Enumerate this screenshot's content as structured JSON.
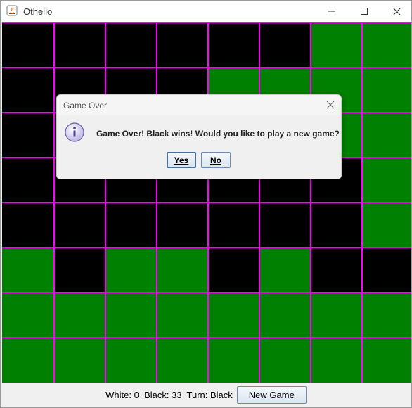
{
  "window": {
    "title": "Othello"
  },
  "colors": {
    "green": "#008000",
    "black": "#000000",
    "grid": "#ff00ff"
  },
  "board": {
    "rows": [
      [
        "B",
        "B",
        "B",
        "B",
        "B",
        "B",
        "G",
        "G"
      ],
      [
        "B",
        "B",
        "B",
        "B",
        "G",
        "G",
        "G",
        "G"
      ],
      [
        "B",
        "B",
        "B",
        "B",
        "B",
        "B",
        "G",
        "G"
      ],
      [
        "B",
        "B",
        "B",
        "B",
        "B",
        "B",
        "B",
        "G"
      ],
      [
        "B",
        "B",
        "B",
        "B",
        "B",
        "B",
        "B",
        "G"
      ],
      [
        "G",
        "B",
        "G",
        "G",
        "B",
        "G",
        "B",
        "B"
      ],
      [
        "G",
        "G",
        "G",
        "G",
        "G",
        "G",
        "G",
        "G"
      ],
      [
        "G",
        "G",
        "G",
        "G",
        "G",
        "G",
        "G",
        "G"
      ]
    ]
  },
  "status": {
    "text": "White: 0  Black: 33  Turn: Black",
    "new_game_label": "New Game"
  },
  "dialog": {
    "title": "Game Over",
    "message": "Game Over! Black wins! Would you like to play a new game?",
    "yes_label": "Yes",
    "no_label": "No"
  }
}
